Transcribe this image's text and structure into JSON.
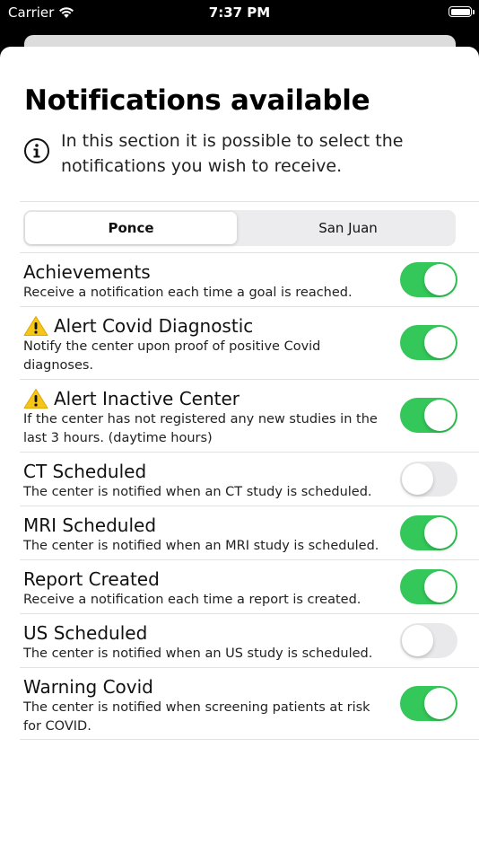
{
  "status_bar": {
    "carrier": "Carrier",
    "time": "7:37 PM"
  },
  "header": {
    "title": "Notifications available",
    "info_text": "In this section it is possible to select the notifications you wish to receive."
  },
  "segmented_control": {
    "segments": [
      "Ponce",
      "San Juan"
    ],
    "selected": "Ponce"
  },
  "notifications": [
    {
      "title": "Achievements",
      "description": "Receive a notification each time a goal is reached.",
      "warning": false,
      "enabled": true
    },
    {
      "title": "Alert Covid Diagnostic",
      "description": "Notify the center upon proof of positive Covid diagnoses.",
      "warning": true,
      "enabled": true
    },
    {
      "title": "Alert Inactive Center",
      "description": "If the center has not registered any new studies in the last 3 hours. (daytime hours)",
      "warning": true,
      "enabled": true
    },
    {
      "title": "CT Scheduled",
      "description": "The center is notified when an CT study is scheduled.",
      "warning": false,
      "enabled": false
    },
    {
      "title": "MRI Scheduled",
      "description": "The center is notified when an MRI study is scheduled.",
      "warning": false,
      "enabled": true
    },
    {
      "title": "Report Created",
      "description": "Receive a notification each time a report is created.",
      "warning": false,
      "enabled": true
    },
    {
      "title": "US Scheduled",
      "description": "The center is notified when an US study is scheduled.",
      "warning": false,
      "enabled": false
    },
    {
      "title": "Warning Covid",
      "description": "The center is notified when screening patients at risk for COVID.",
      "warning": false,
      "enabled": true
    }
  ],
  "colors": {
    "toggle_on": "#34c759",
    "toggle_off": "#e9e9eb",
    "warning": "#f5c518"
  },
  "icons": {
    "info": "info-circle-icon",
    "warning": "warning-triangle-icon",
    "wifi": "wifi-icon",
    "battery": "battery-icon"
  }
}
